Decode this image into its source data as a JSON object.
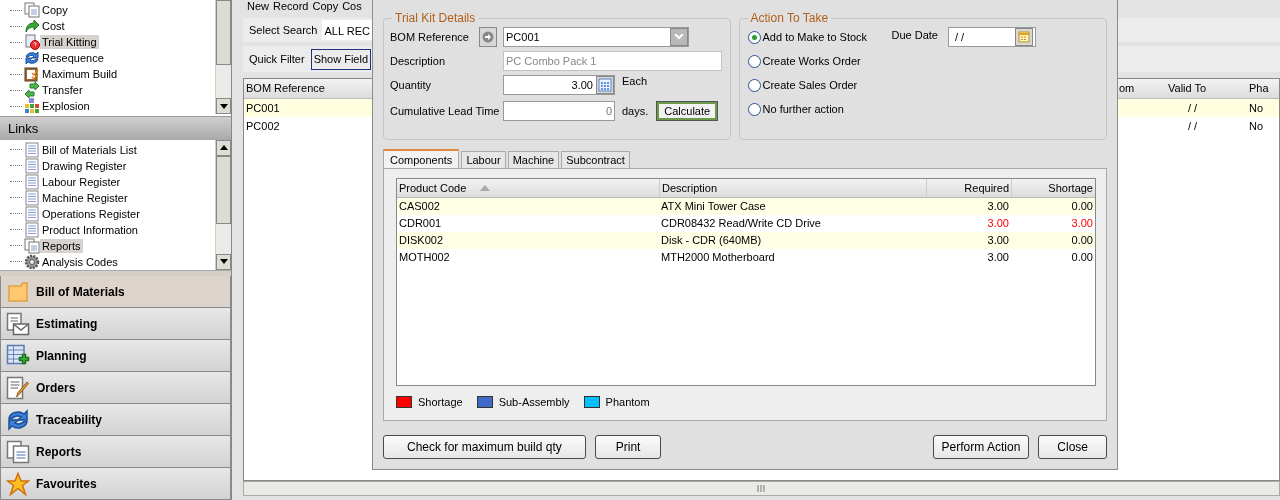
{
  "sidebar": {
    "tasks": [
      {
        "label": "Copy",
        "selected": false
      },
      {
        "label": "Cost",
        "selected": false
      },
      {
        "label": "Trial Kitting",
        "selected": true
      },
      {
        "label": "Resequence",
        "selected": false
      },
      {
        "label": "Maximum Build",
        "selected": false
      },
      {
        "label": "Transfer",
        "selected": false
      },
      {
        "label": "Explosion",
        "selected": false
      }
    ],
    "links_header": "Links",
    "links": [
      {
        "label": "Bill of Materials List",
        "selected": false
      },
      {
        "label": "Drawing Register",
        "selected": false
      },
      {
        "label": "Labour Register",
        "selected": false
      },
      {
        "label": "Machine Register",
        "selected": false
      },
      {
        "label": "Operations Register",
        "selected": false
      },
      {
        "label": "Product Information",
        "selected": false
      },
      {
        "label": "Reports",
        "selected": true
      },
      {
        "label": "Analysis Codes",
        "selected": false
      }
    ],
    "modules": [
      {
        "label": "Bill of Materials",
        "selected": true
      },
      {
        "label": "Estimating",
        "selected": false
      },
      {
        "label": "Planning",
        "selected": false
      },
      {
        "label": "Orders",
        "selected": false
      },
      {
        "label": "Traceability",
        "selected": false
      },
      {
        "label": "Reports",
        "selected": false
      },
      {
        "label": "Favourites",
        "selected": false
      }
    ]
  },
  "toolbar": {
    "items": [
      "New",
      "Record",
      "Copy",
      "Cos"
    ],
    "search_label": "Select Search",
    "search_value": "ALL REC",
    "quick_filter": "Quick Filter",
    "show_fields": "Show Field"
  },
  "grid": {
    "columns": [
      "BOM Reference",
      "om",
      "Valid To",
      "Pha"
    ],
    "rows": [
      {
        "bom_reference": "PC001",
        "valid_to": "/ /",
        "column_4": "No",
        "selected": true
      },
      {
        "bom_reference": "PC002",
        "valid_to": "/ /",
        "column_4": "No",
        "selected": false
      }
    ]
  },
  "dialog": {
    "trial_kit": {
      "title": "Trial Kit Details",
      "bom_reference": {
        "label": "BOM Reference",
        "value": "PC001"
      },
      "description": {
        "label": "Description",
        "value": "PC Combo Pack 1",
        "disabled": true
      },
      "quantity": {
        "label": "Quantity",
        "value": "3.00",
        "unit": "Each"
      },
      "lead_time": {
        "label": "Cumulative Lead Time",
        "value": "0",
        "unit": "days."
      },
      "calculate": {
        "label": "Calculate",
        "focused": true
      }
    },
    "action": {
      "title": "Action To Take",
      "options": [
        {
          "label": "Add to Make to Stock",
          "selected": true
        },
        {
          "label": "Create Works Order",
          "selected": false
        },
        {
          "label": "Create Sales Order",
          "selected": false
        },
        {
          "label": "No further action",
          "selected": false
        }
      ],
      "due_date": {
        "label": "Due Date",
        "value": "/ /"
      }
    },
    "tabs": [
      {
        "label": "Components",
        "selected": true
      },
      {
        "label": "Labour",
        "selected": false
      },
      {
        "label": "Machine",
        "selected": false
      },
      {
        "label": "Subcontract",
        "selected": false
      }
    ],
    "components": {
      "columns": [
        "Product Code",
        "Description",
        "Required",
        "Shortage"
      ],
      "rows": [
        {
          "product_code": "CAS002",
          "description": "ATX Mini Tower Case",
          "required": "3.00",
          "shortage": "0.00",
          "is_shortage": false
        },
        {
          "product_code": "CDR001",
          "description": "CDR08432 Read/Write CD Drive",
          "required": "3.00",
          "shortage": "3.00",
          "is_shortage": true
        },
        {
          "product_code": "DISK002",
          "description": "Disk - CDR (640MB)",
          "required": "3.00",
          "shortage": "0.00",
          "is_shortage": false
        },
        {
          "product_code": "MOTH002",
          "description": "MTH2000 Motherboard",
          "required": "3.00",
          "shortage": "0.00",
          "is_shortage": false
        }
      ]
    },
    "legend": [
      {
        "label": "Shortage",
        "color": "#ff0000"
      },
      {
        "label": "Sub-Assembly",
        "color": "#4169c8"
      },
      {
        "label": "Phantom",
        "color": "#00bfff"
      }
    ],
    "buttons_left": [
      "Check for maximum build qty",
      "Print"
    ],
    "buttons_right": [
      "Perform Action",
      "Close"
    ]
  }
}
